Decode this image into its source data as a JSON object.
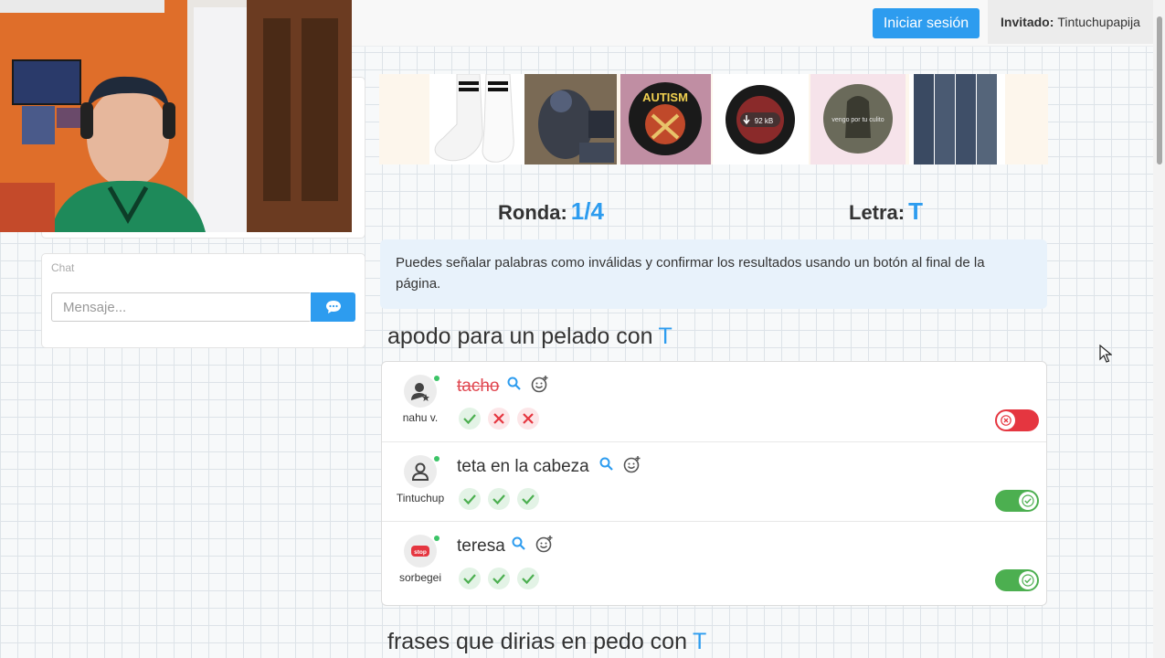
{
  "header": {
    "login_label": "Iniciar sesión",
    "guest_prefix": "Invitado:",
    "guest_name": "Tintuchupapija"
  },
  "chat": {
    "title": "Chat",
    "placeholder": "Mensaje..."
  },
  "game": {
    "round_label": "Ronda:",
    "round_value": "1/4",
    "letter_label": "Letra:",
    "letter_value": "T"
  },
  "info_text": "Puedes señalar palabras como inválidas y confirmar los resultados usando un botón al final de la página.",
  "categories": [
    {
      "title": "apodo para un pelado con",
      "letter": "T",
      "answers": [
        {
          "user": "nahu v.",
          "word": "tacho",
          "valid": false,
          "votes": [
            "ok",
            "no",
            "no"
          ]
        },
        {
          "user": "Tintuchup",
          "word": "teta en la cabeza",
          "valid": true,
          "votes": [
            "ok",
            "ok",
            "ok"
          ]
        },
        {
          "user": "sorbegei",
          "word": "teresa",
          "valid": true,
          "votes": [
            "ok",
            "ok",
            "ok"
          ]
        }
      ]
    },
    {
      "title": "frases que dirias en pedo con",
      "letter": "T"
    }
  ],
  "images": [
    {
      "name": "socks-image"
    },
    {
      "name": "pigeon-backpack-image"
    },
    {
      "name": "autism-pin-image"
    },
    {
      "name": "download-face-image",
      "caption": "92 kB"
    },
    {
      "name": "soldier-pin-image",
      "caption": "vengo por tu culito"
    },
    {
      "name": "jeans-image"
    }
  ],
  "colors": {
    "accent": "#2d9cef",
    "valid": "#4caf50",
    "invalid": "#e53640"
  }
}
